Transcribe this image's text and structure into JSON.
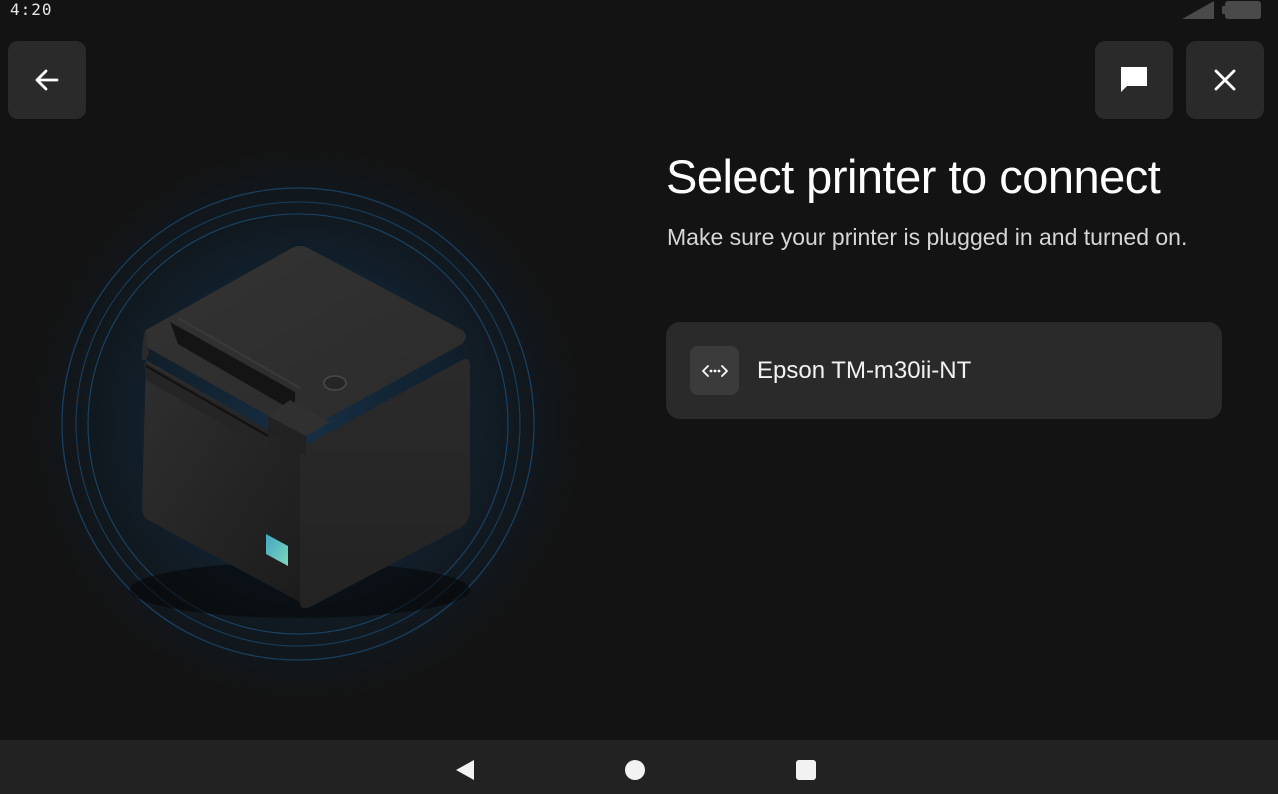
{
  "status_bar": {
    "time": "4:20",
    "icons": [
      "signal-icon",
      "battery-icon"
    ]
  },
  "toolbar": {
    "back_icon": "arrow-left-icon",
    "chat_icon": "chat-bubble-icon",
    "close_icon": "close-icon"
  },
  "main": {
    "title": "Select printer to connect",
    "subtitle": "Make sure your printer is plugged in and turned on.",
    "illustration": "printer-illustration",
    "printers": [
      {
        "name": "Epson TM-m30ii-NT",
        "icon": "network-connection-icon"
      }
    ]
  },
  "nav_bar": {
    "icons": [
      "nav-back-icon",
      "nav-home-icon",
      "nav-recents-icon"
    ]
  },
  "colors": {
    "background": "#131313",
    "button_bg": "#2a2a2a",
    "ring_glow": "#1d4d73",
    "status_light": "#4fb9c9"
  }
}
